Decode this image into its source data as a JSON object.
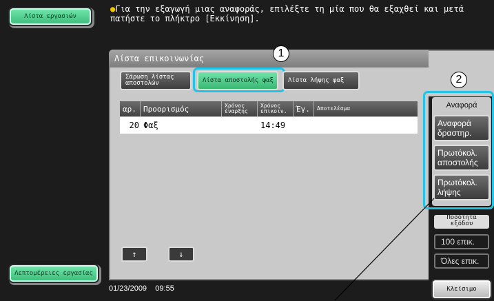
{
  "left_nav": {
    "job_list_label": "Λίστα εργασιών",
    "job_details_label": "Λεπτομέρειες εργασίας"
  },
  "message": "Για την εξαγωγή μιας αναφοράς, επιλέξτε τη μία που θα εξαχθεί και μετά πατήστε το πλήκτρο [Εκκίνηση].",
  "panel": {
    "title": "Λίστα επικοινωνίας",
    "tabs": [
      {
        "label": "Σάρωση λίστας αποστολών",
        "active": false
      },
      {
        "label": "Λίστα αποστολής φαξ",
        "active": true
      },
      {
        "label": "Λίστα λήψης φαξ",
        "active": false
      }
    ]
  },
  "table": {
    "columns": [
      "αρ.",
      "Προορισμός",
      "Χρόνος έναρξης",
      "Χρόνος επικοιν.",
      "Έγ.",
      "Αποτελέσμα"
    ],
    "rows": [
      {
        "no": "20",
        "destination": "Φαξ",
        "start": "",
        "comm_time": "14:49",
        "pages": "",
        "result": ""
      }
    ]
  },
  "nav_arrows": {
    "up": "↑",
    "down": "↓"
  },
  "report": {
    "header": "Αναφορά",
    "buttons": [
      "Αναφορά δραστηρ.",
      "Πρωτόκολ. αποστολής",
      "Πρωτόκολ. λήψης"
    ]
  },
  "quantity": {
    "header": "Ποσότητα εξόδου",
    "options": [
      "100 επικ.",
      "Όλες επικ."
    ]
  },
  "close_label": "Κλείσιμο",
  "status": {
    "date": "01/23/2009",
    "time": "09:55"
  },
  "callouts": [
    "1",
    "2"
  ],
  "colors": {
    "accent_green": "#4fd18d",
    "callout_cyan": "#21c4e6",
    "hint_yellow": "#f2c400"
  }
}
